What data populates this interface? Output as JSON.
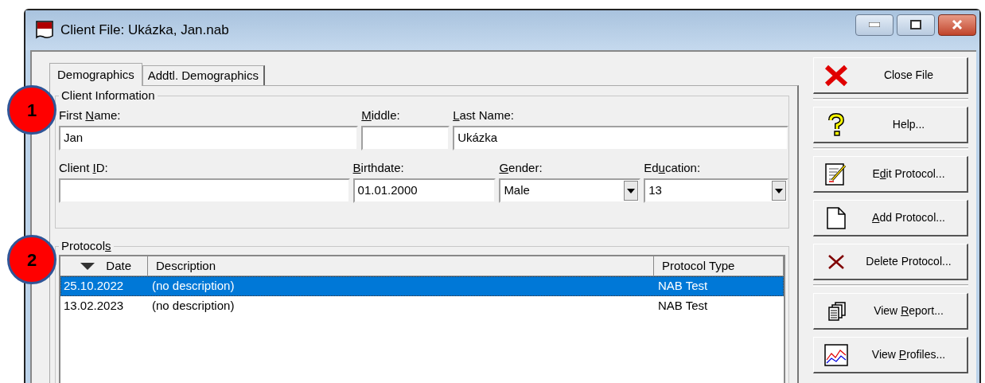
{
  "window": {
    "title": "Client File: Ukázka, Jan.nab"
  },
  "tabs": [
    {
      "label": "Demographics",
      "selected": true
    },
    {
      "label": "Addtl. Demographics",
      "selected": false
    }
  ],
  "client_information": {
    "title": "Client Information",
    "rows": [
      [
        {
          "kind": "text",
          "label": [
            {
              "text": "First ",
              "underlined": false
            },
            {
              "text": "N",
              "underlined": true
            },
            {
              "text": "ame:",
              "underlined": false
            }
          ],
          "value": "Jan"
        },
        {
          "kind": "text",
          "label": [
            {
              "text": "M",
              "underlined": true
            },
            {
              "text": "iddle:",
              "underlined": false
            }
          ]
        },
        {
          "kind": "text",
          "label": [
            {
              "text": "L",
              "underlined": true
            },
            {
              "text": "ast Name:",
              "underlined": false
            }
          ],
          "value": "Ukázka"
        }
      ],
      [
        {
          "kind": "text",
          "label": [
            {
              "text": "Client ",
              "underlined": false
            },
            {
              "text": "I",
              "underlined": true
            },
            {
              "text": "D:",
              "underlined": false
            }
          ]
        },
        {
          "kind": "text",
          "label": [
            {
              "text": "B",
              "underlined": true
            },
            {
              "text": "irthdate:",
              "underlined": false
            }
          ],
          "value": "01.01.2000"
        },
        {
          "kind": "select",
          "label": [
            {
              "text": "G",
              "underlined": true
            },
            {
              "text": "ender:",
              "underlined": false
            }
          ],
          "value": "Male"
        },
        {
          "kind": "select",
          "label": [
            {
              "text": "Ed",
              "underlined": false
            },
            {
              "text": "u",
              "underlined": true
            },
            {
              "text": "cation:",
              "underlined": false
            }
          ],
          "value": "13"
        }
      ]
    ]
  },
  "protocols": {
    "title": [
      {
        "text": "Protocol",
        "underlined": false
      },
      {
        "text": "s",
        "underlined": true
      }
    ],
    "columns": [
      {
        "label": "Date",
        "sorted": true
      },
      {
        "label": "Description",
        "sorted": false
      },
      {
        "label": "Protocol Type",
        "sorted": false
      }
    ],
    "rows": [
      {
        "cells": [
          "25.10.2022",
          "(no description)",
          "NAB Test"
        ],
        "selected": true
      },
      {
        "cells": [
          "13.02.2023",
          "(no description)",
          "NAB Test"
        ],
        "selected": false
      }
    ]
  },
  "actions": [
    {
      "kind": "close",
      "label": [
        {
          "text": "Close File",
          "underlined": false
        }
      ],
      "separator_after": true
    },
    {
      "kind": "help",
      "label": [
        {
          "text": "Help...",
          "underlined": false
        }
      ],
      "separator_after": true
    },
    {
      "kind": "edit",
      "label": [
        {
          "text": "E",
          "underlined": false
        },
        {
          "text": "d",
          "underlined": true
        },
        {
          "text": "it Protocol...",
          "underlined": false
        }
      ],
      "separator_after": false
    },
    {
      "kind": "add",
      "label": [
        {
          "text": "A",
          "underlined": true
        },
        {
          "text": "dd Protocol...",
          "underlined": false
        }
      ],
      "separator_after": false
    },
    {
      "kind": "delete",
      "label": [
        {
          "text": "Delete Protocol...",
          "underlined": false
        }
      ],
      "separator_after": true
    },
    {
      "kind": "report",
      "label": [
        {
          "text": "View ",
          "underlined": false
        },
        {
          "text": "R",
          "underlined": true
        },
        {
          "text": "eport...",
          "underlined": false
        }
      ],
      "separator_after": false
    },
    {
      "kind": "profiles",
      "label": [
        {
          "text": "View ",
          "underlined": false
        },
        {
          "text": "P",
          "underlined": true
        },
        {
          "text": "rofiles...",
          "underlined": false
        }
      ],
      "separator_after": false
    }
  ],
  "callouts": [
    "1",
    "2"
  ]
}
